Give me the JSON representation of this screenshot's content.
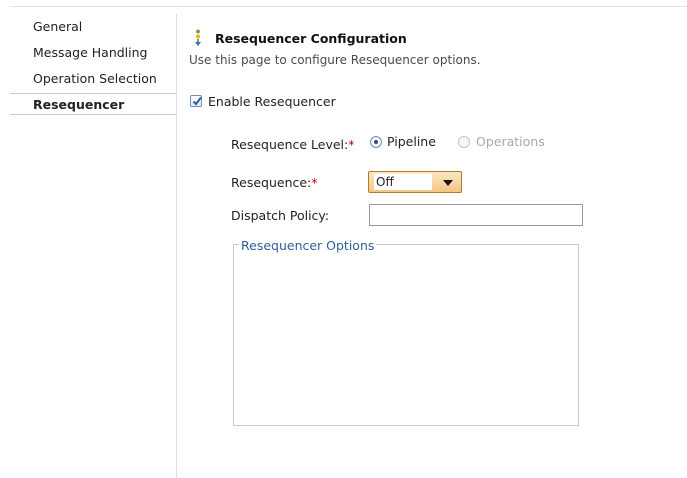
{
  "sidebar": {
    "items": [
      {
        "label": "General",
        "active": false
      },
      {
        "label": "Message Handling",
        "active": false
      },
      {
        "label": "Operation Selection",
        "active": false
      },
      {
        "label": "Resequencer",
        "active": true
      }
    ]
  },
  "header": {
    "icon": "resequencer-config-icon",
    "title": "Resequencer Configuration",
    "description": "Use this page to configure Resequencer options."
  },
  "form": {
    "enable_checkbox": {
      "label": "Enable Resequencer",
      "checked": true
    },
    "level": {
      "label": "Resequence Level:",
      "required_mark": "*",
      "options": [
        {
          "label": "Pipeline",
          "selected": true,
          "enabled": true
        },
        {
          "label": "Operations",
          "selected": false,
          "enabled": false
        }
      ]
    },
    "resequence": {
      "label": "Resequence:",
      "required_mark": "*",
      "selected": "Off"
    },
    "dispatch_policy": {
      "label": "Dispatch Policy:",
      "value": ""
    },
    "options_group": {
      "legend": "Resequencer Options"
    }
  },
  "colors": {
    "accent": "#2f5f9a",
    "required": "#d00000",
    "select_bg": "#f3c784"
  }
}
